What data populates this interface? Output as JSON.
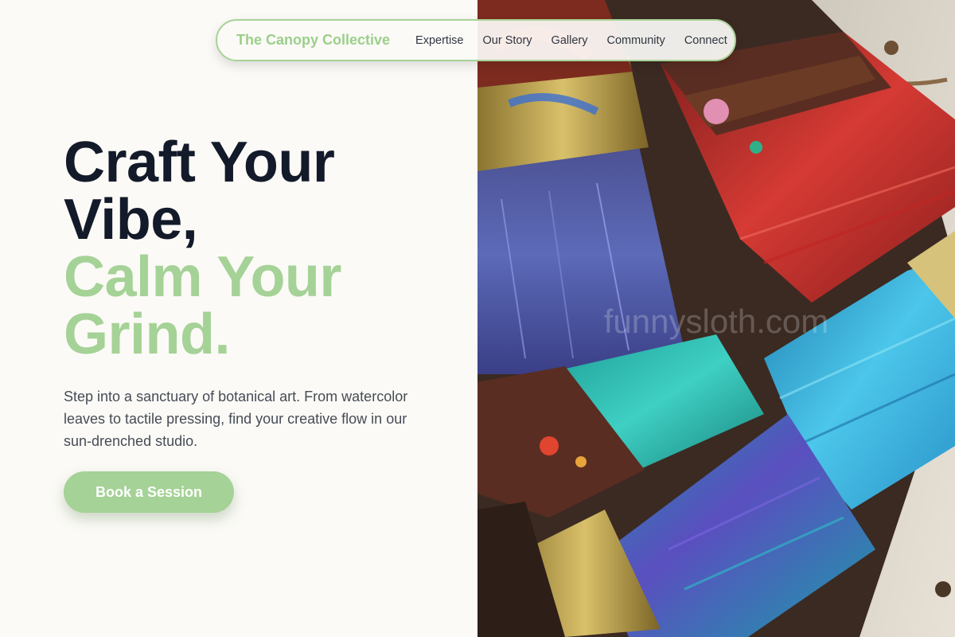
{
  "nav": {
    "brand": "The Canopy Collective",
    "links": [
      "Expertise",
      "Our Story",
      "Gallery",
      "Community",
      "Connect"
    ]
  },
  "hero": {
    "headline_line1": "Craft Your",
    "headline_line2": "Vibe,",
    "headline_line3": "Calm Your",
    "headline_line4": "Grind.",
    "description": "Step into a sanctuary of botanical art. From watercolor leaves to tactile pressing, find your creative flow in our sun-drenched studio.",
    "cta_label": "Book a Session"
  },
  "image": {
    "subject": "paint-brushes-photo",
    "watermark": "funnysloth.com"
  },
  "colors": {
    "accent_green": "#a5d296",
    "headline_dark": "#131a2a",
    "background": "#fbfaf6",
    "body_text": "#464c56"
  }
}
